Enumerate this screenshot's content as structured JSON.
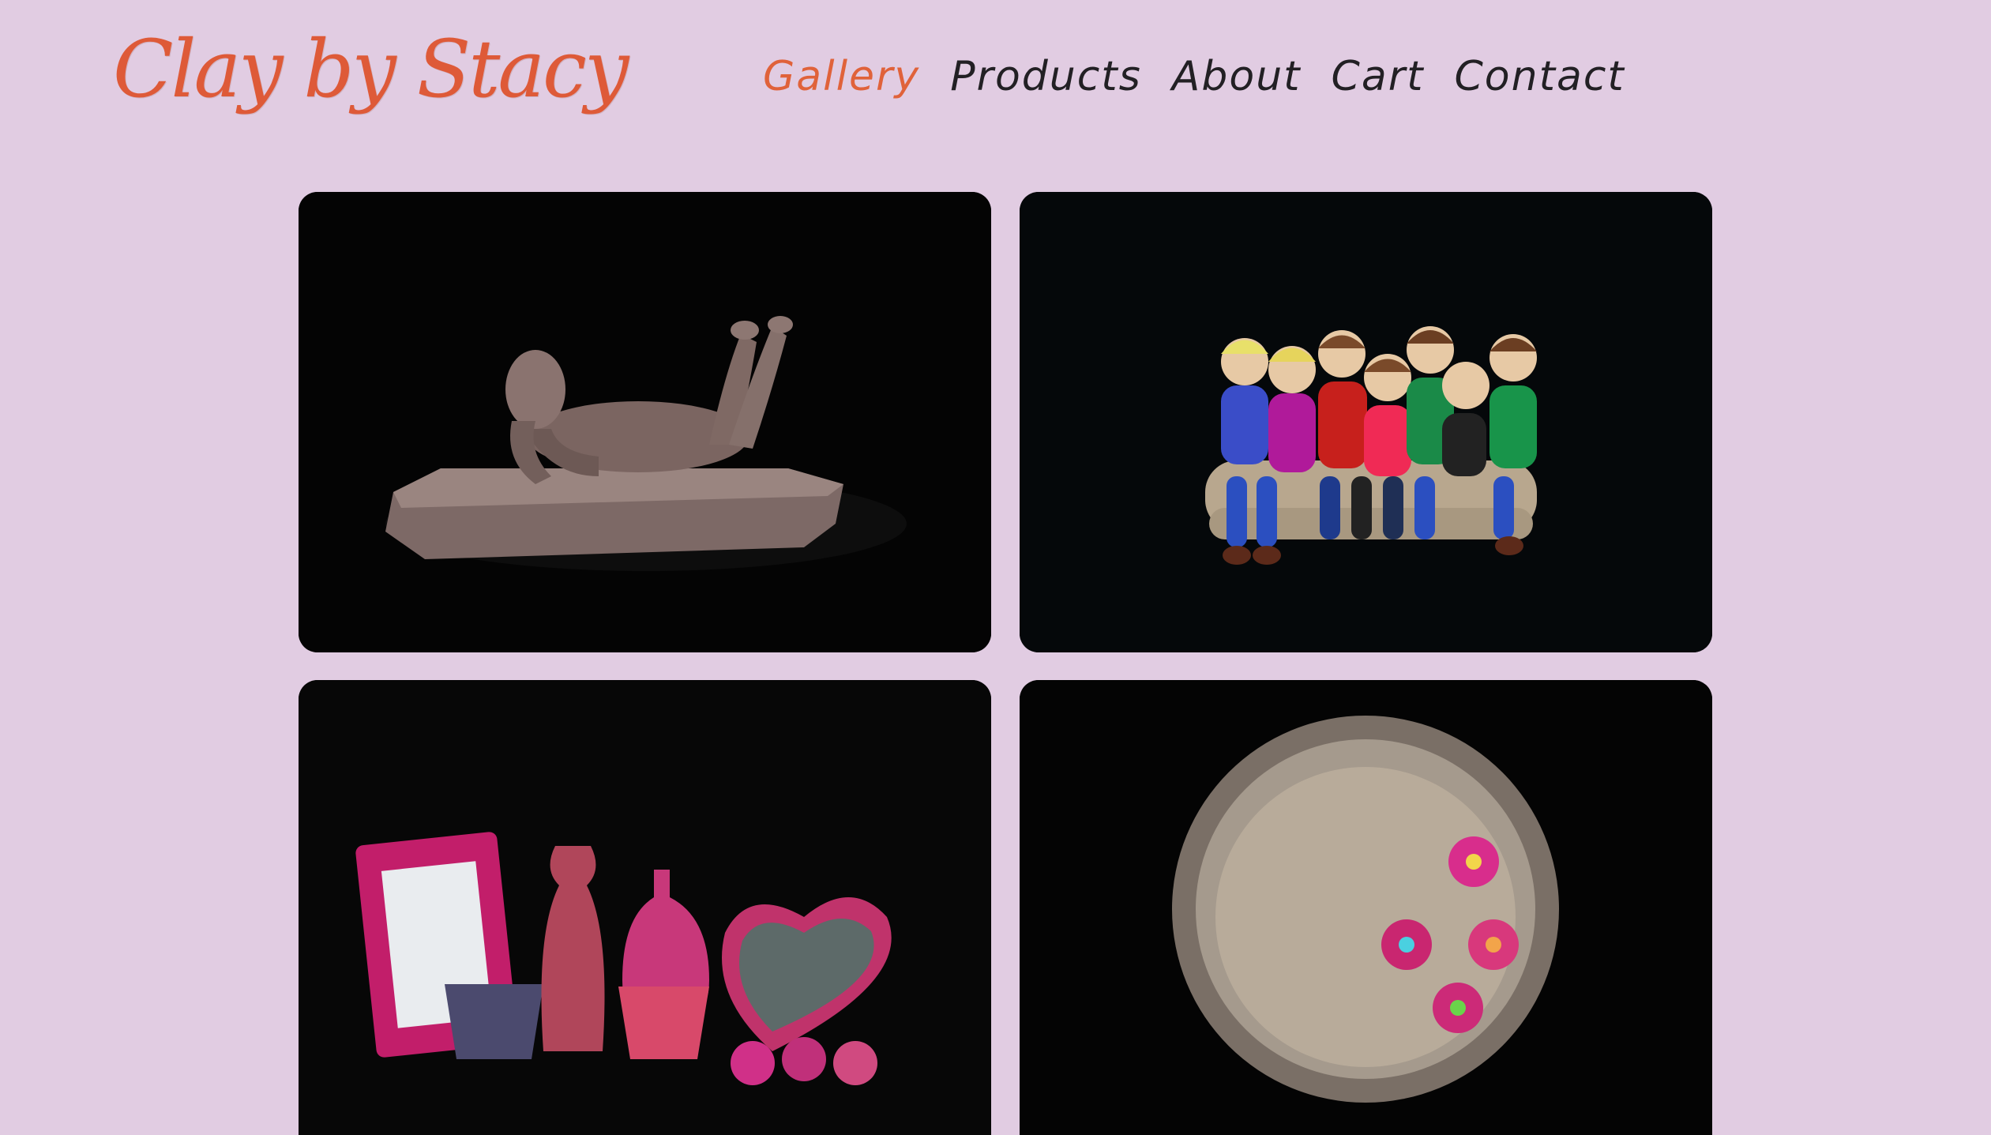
{
  "header": {
    "logo_text": "Clay by Stacy",
    "nav": [
      {
        "label": "Gallery",
        "active": true
      },
      {
        "label": "Products",
        "active": false
      },
      {
        "label": "About",
        "active": false
      },
      {
        "label": "Cart",
        "active": false
      },
      {
        "label": "Contact",
        "active": false
      }
    ]
  },
  "colors": {
    "background": "#e1cce2",
    "accent": "#de5a38",
    "nav_text": "#222024",
    "photo_background": "#050505"
  },
  "gallery": {
    "items": [
      {
        "subject": "reclining clay figure sculpture"
      },
      {
        "subject": "polymer clay family figures on a sofa"
      },
      {
        "subject": "millefiori polymer clay frame, vases and heart dish"
      },
      {
        "subject": "millefiori clay beads in a fluted tin pan"
      }
    ]
  }
}
